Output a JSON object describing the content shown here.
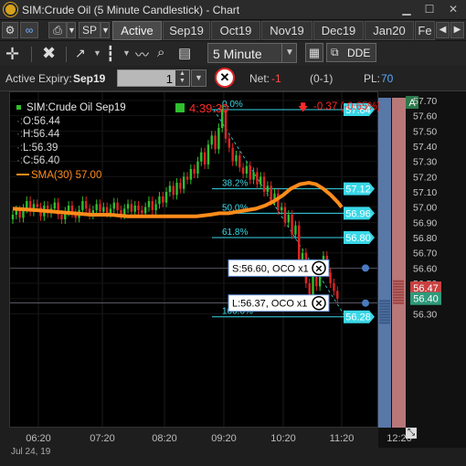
{
  "window": {
    "title": "SIM:Crude Oil (5 Minute Candlestick) - Chart"
  },
  "toolbar": {
    "sp_label": "SP",
    "tabs": [
      "Active",
      "Sep19",
      "Oct19",
      "Nov19",
      "Dec19",
      "Jan20",
      "Fe"
    ],
    "interval": "5 Minute",
    "dde_label": "DDE"
  },
  "order_bar": {
    "active_expiry_label": "Active Expiry:",
    "active_expiry_value": "Sep19",
    "quantity": "1",
    "net_label": "Net:",
    "net_value": "-1",
    "net_paren": "(0-1)",
    "pl_label": "PL:",
    "pl_value": "70"
  },
  "legend": {
    "symbol": "SIM:Crude Oil Sep19",
    "open": "O:56.44",
    "high": "H:56.44",
    "low": "L:56.39",
    "close": "C:56.40",
    "sma": "SMA(30)  57.00",
    "timer": "4:39:30",
    "change": "-0.37 (-0.65%)"
  },
  "fib": [
    {
      "pct": "0.0%",
      "price": "57.64",
      "value": 57.64
    },
    {
      "pct": "38.2%",
      "price": "57.12",
      "value": 57.12
    },
    {
      "pct": "50.0%",
      "price": "56.96",
      "value": 56.96
    },
    {
      "pct": "61.8%",
      "price": "56.80",
      "value": 56.8
    },
    {
      "pct": "100.0%",
      "price": "56.28",
      "value": 56.28
    }
  ],
  "orders": [
    {
      "text": "S:56.60, OCO x1",
      "value": 56.6
    },
    {
      "text": "L:56.37, OCO x1",
      "value": 56.37
    }
  ],
  "price_axis": {
    "ticks": [
      "57.70",
      "57.60",
      "57.50",
      "57.40",
      "57.30",
      "57.20",
      "57.10",
      "57.00",
      "56.90",
      "56.80",
      "56.70",
      "56.60",
      "56.50",
      "56.40",
      "56.30"
    ],
    "tick_values": [
      57.7,
      57.6,
      57.5,
      57.4,
      57.3,
      57.2,
      57.1,
      57.0,
      56.9,
      56.8,
      56.7,
      56.6,
      56.5,
      56.4,
      56.3
    ],
    "ask_marker": "56.47",
    "bid_marker": "56.40",
    "a_label": "A"
  },
  "time_axis": {
    "ticks": [
      "06:20",
      "07:20",
      "08:20",
      "09:20",
      "10:20",
      "11:20",
      "12:20"
    ],
    "date": "Jul 24, 19"
  },
  "colors": {
    "up": "#2fbf2f",
    "down": "#e02424",
    "sma": "#ff8c1a",
    "fib": "#38d8e8",
    "ask": "#c94040",
    "bid": "#2e9a7a"
  }
}
